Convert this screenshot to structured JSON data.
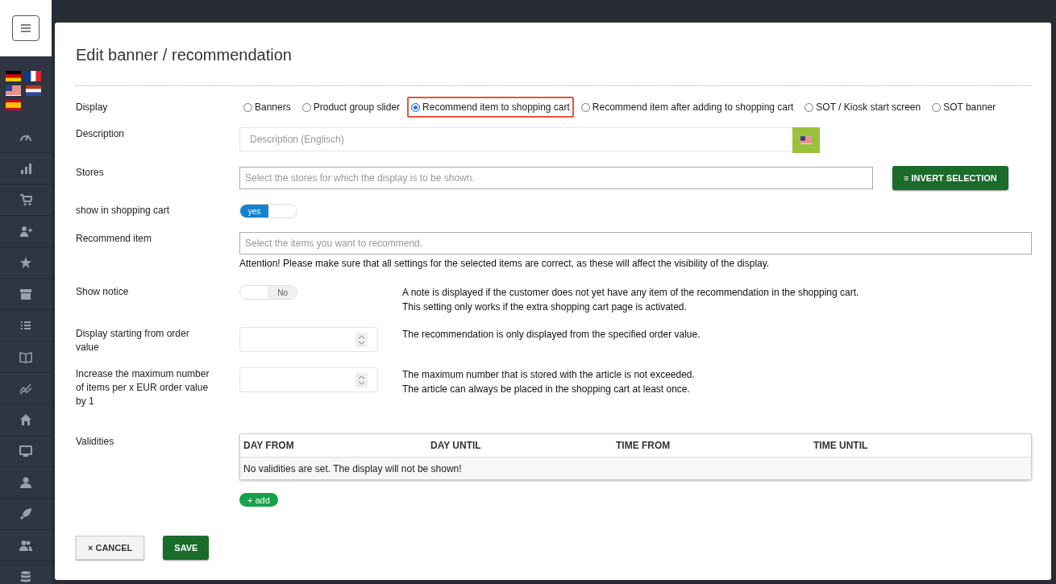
{
  "title": "Edit banner / recommendation",
  "display": {
    "label": "Display",
    "options": [
      {
        "label": "Banners",
        "selected": false,
        "highlighted": false
      },
      {
        "label": "Product group slider",
        "selected": false,
        "highlighted": false
      },
      {
        "label": "Recommend item to shopping cart",
        "selected": true,
        "highlighted": true
      },
      {
        "label": "Recommend item after adding to shopping cart",
        "selected": false,
        "highlighted": false
      },
      {
        "label": "SOT / Kiosk start screen",
        "selected": false,
        "highlighted": false
      },
      {
        "label": "SOT banner",
        "selected": false,
        "highlighted": false
      }
    ]
  },
  "description": {
    "label": "Description",
    "placeholder": "Description (Englisch)"
  },
  "stores": {
    "label": "Stores",
    "placeholder": "Select the stores for which the display is to be shown.",
    "button": "≡ INVERT SELECTION"
  },
  "show_in_cart": {
    "label": "show in shopping cart",
    "on": true,
    "text": "yes"
  },
  "recommend_item": {
    "label": "Recommend item",
    "placeholder": "Select the items you want to recommend.",
    "note": "Attention! Please make sure that all settings for the selected items are correct, as these will affect the visibility of the display."
  },
  "show_notice": {
    "label": "Show notice",
    "on": false,
    "text": "No",
    "help": [
      "A note is displayed if the customer does not yet have any item of the recommendation in the shopping cart.",
      "This setting only works if the extra shopping cart page is activated."
    ]
  },
  "order_value": {
    "label": "Display starting from order value",
    "help": [
      "The recommendation is only displayed from the specified order value."
    ]
  },
  "max_items": {
    "label": "Increase the maximum number of items per x EUR order value by 1",
    "help": [
      "The maximum number that is stored with the article is not exceeded.",
      "The article can always be placed in the shopping cart at least once."
    ]
  },
  "validities": {
    "label": "Validities",
    "columns": [
      "DAY FROM",
      "DAY UNTIL",
      "TIME FROM",
      "TIME UNTIL"
    ],
    "empty_text": "No validities are set. The display will not be shown!",
    "add_button": "+ add"
  },
  "buttons": {
    "cancel": "× CANCEL",
    "save": "SAVE"
  }
}
